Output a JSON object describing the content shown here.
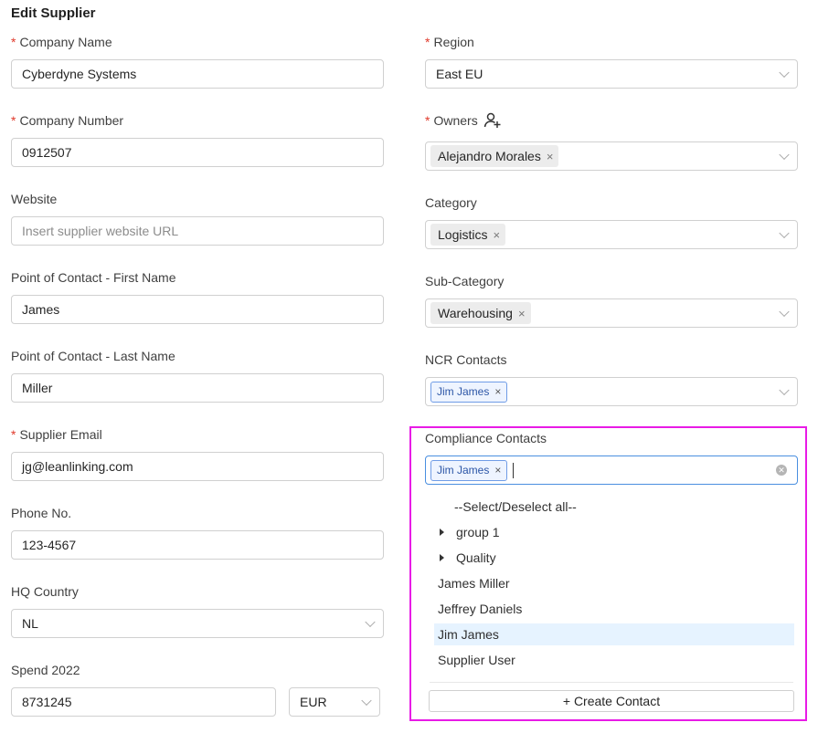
{
  "form": {
    "title": "Edit Supplier",
    "required_mark": "*",
    "left": {
      "company_name": {
        "label": "Company Name",
        "value": "Cyberdyne Systems"
      },
      "company_number": {
        "label": "Company Number",
        "value": "0912507"
      },
      "website": {
        "label": "Website",
        "placeholder": "Insert supplier website URL"
      },
      "poc_first": {
        "label": "Point of Contact - First Name",
        "value": "James"
      },
      "poc_last": {
        "label": "Point of Contact - Last Name",
        "value": "Miller"
      },
      "supplier_email": {
        "label": "Supplier Email",
        "value": "jg@leanlinking.com"
      },
      "phone": {
        "label": "Phone No.",
        "value": "123-4567"
      },
      "hq_country": {
        "label": "HQ Country",
        "value": "NL"
      },
      "spend": {
        "label": "Spend 2022",
        "value": "8731245",
        "currency": "EUR"
      }
    },
    "right": {
      "region": {
        "label": "Region",
        "value": "East EU"
      },
      "owners": {
        "label": "Owners",
        "tag": "Alejandro Morales"
      },
      "category": {
        "label": "Category",
        "tag": "Logistics"
      },
      "sub_category": {
        "label": "Sub-Category",
        "tag": "Warehousing"
      },
      "ncr_contacts": {
        "label": "NCR Contacts",
        "tag": "Jim James"
      },
      "compliance_contacts": {
        "label": "Compliance Contacts",
        "tag": "Jim James"
      }
    },
    "tag_close": "×"
  },
  "dropdown": {
    "options": [
      {
        "label": "--Select/Deselect all--",
        "kind": "all"
      },
      {
        "label": "group 1",
        "kind": "group"
      },
      {
        "label": "Quality",
        "kind": "group"
      },
      {
        "label": "James Miller",
        "kind": "item"
      },
      {
        "label": "Jeffrey Daniels",
        "kind": "item"
      },
      {
        "label": "Jim James",
        "kind": "item",
        "active": true
      },
      {
        "label": "Supplier User",
        "kind": "item"
      }
    ],
    "create_label": "+ Create Contact"
  },
  "icons": {
    "owner_add": "user-plus-icon",
    "clear": "clear-circle-icon",
    "chevron": "chevron-down-icon",
    "caret": "caret-right-icon"
  },
  "colors": {
    "highlight": "#e81be6",
    "required": "#e0392b",
    "active_option": "#e6f3ff",
    "focused_border": "#4a8fe0"
  }
}
